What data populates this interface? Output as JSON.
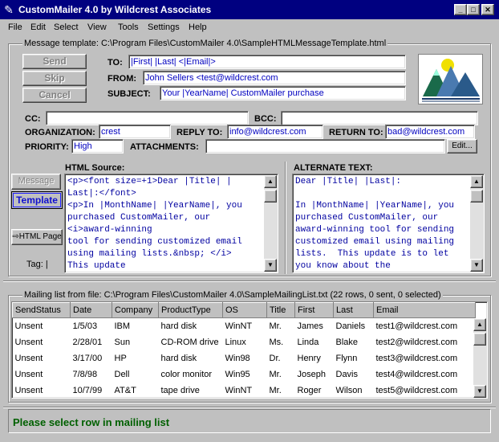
{
  "window": {
    "title": "CustomMailer 4.0 by Wildcrest Associates"
  },
  "menu": [
    "File",
    "Edit",
    "Select",
    "View",
    "Tools",
    "Settings",
    "Help"
  ],
  "template_group": {
    "label": "Message template: C:\\Program Files\\CustomMailer 4.0\\SampleHTMLMessageTemplate.html"
  },
  "buttons": {
    "send": "Send",
    "skip": "Skip",
    "cancel": "Cancel",
    "message": "Message",
    "template": "Template",
    "html_page": "HTML Page",
    "edit": "Edit..."
  },
  "fields": {
    "to": {
      "label": "TO:",
      "value": "|First| |Last| <|Email|>"
    },
    "from": {
      "label": "FROM:",
      "value": "John Sellers <test@wildcrest.com"
    },
    "subject": {
      "label": "SUBJECT:",
      "value": "Your |YearName| CustomMailer purchase"
    },
    "cc": {
      "label": "CC:",
      "value": ""
    },
    "bcc": {
      "label": "BCC:",
      "value": ""
    },
    "organization": {
      "label": "ORGANIZATION:",
      "value": "crest"
    },
    "reply_to": {
      "label": "REPLY TO:",
      "value": "info@wildcrest.com"
    },
    "return_to": {
      "label": "RETURN TO:",
      "value": "bad@wildcrest.com"
    },
    "priority": {
      "label": "PRIORITY:",
      "value": "High"
    },
    "attachments": {
      "label": "ATTACHMENTS:",
      "value": ""
    }
  },
  "html_source": {
    "label": "HTML Source:",
    "lines": [
      "<p><font size=+1>Dear |Title| |",
      "Last|:</font>",
      "<p>In |MonthName| |YearName|, you",
      "purchased CustomMailer, our",
      "<i>award-winning",
      "tool for sending customized email",
      "using mailing lists.&nbsp; </i>",
      "This update"
    ]
  },
  "alternate_text": {
    "label": "ALTERNATE TEXT:",
    "lines": [
      "Dear |Title| |Last|:",
      "",
      "In |MonthName| |YearName|, you",
      "purchased CustomMailer, our",
      "award-winning tool for sending",
      "customized email using mailing",
      "lists.  This update is to let",
      "you know about the"
    ]
  },
  "tag_label": "Tag: |",
  "mailing_group": {
    "label": "Mailing list from file: C:\\Program Files\\CustomMailer 4.0\\SampleMailingList.txt (22 rows, 0 sent, 0 selected)"
  },
  "mailing_table": {
    "columns": [
      "SendStatus",
      "Date",
      "Company",
      "ProductType",
      "OS",
      "Title",
      "First",
      "Last",
      "Email"
    ],
    "rows": [
      [
        "Unsent",
        "1/5/03",
        "IBM",
        "hard disk",
        "WinNT",
        "Mr.",
        "James",
        "Daniels",
        "test1@wildcrest.com"
      ],
      [
        "Unsent",
        "2/28/01",
        "Sun",
        "CD-ROM drive",
        "Linux",
        "Ms.",
        "Linda",
        "Blake",
        "test2@wildcrest.com"
      ],
      [
        "Unsent",
        "3/17/00",
        "HP",
        "hard disk",
        "Win98",
        "Dr.",
        "Henry",
        "Flynn",
        "test3@wildcrest.com"
      ],
      [
        "Unsent",
        "7/8/98",
        "Dell",
        "color monitor",
        "Win95",
        "Mr.",
        "Joseph",
        "Davis",
        "test4@wildcrest.com"
      ],
      [
        "Unsent",
        "10/7/99",
        "AT&T",
        "tape drive",
        "WinNT",
        "Mr.",
        "Roger",
        "Wilson",
        "test5@wildcrest.com"
      ]
    ]
  },
  "status": {
    "text": "Please select row in mailing list",
    "color": "#006000"
  },
  "colors": {
    "titlebar": "#000080",
    "field_text": "#0000c0",
    "face": "#c0c0c0"
  }
}
